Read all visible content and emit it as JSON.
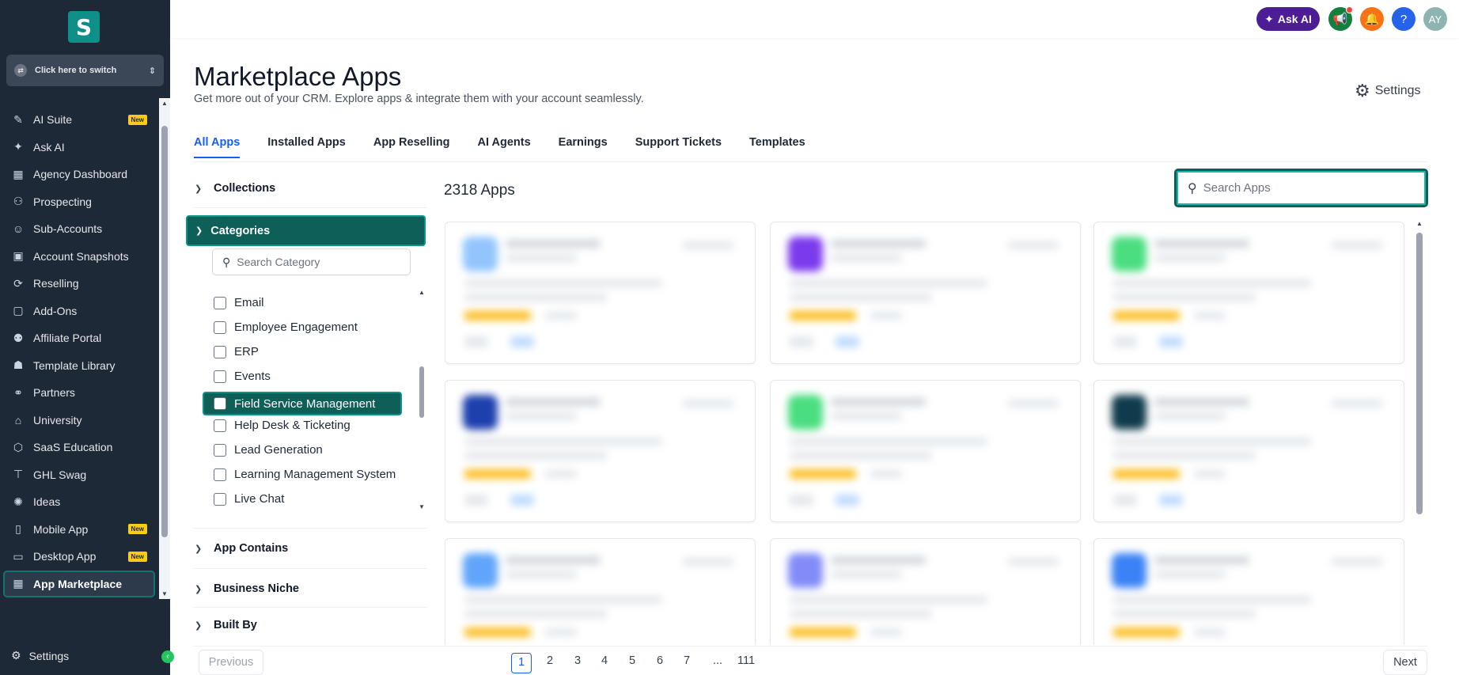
{
  "sidebar": {
    "switcher_label": "Click here to switch",
    "items": [
      {
        "label": "AI Suite",
        "badge": "New",
        "icon": "sparkle-pen-icon"
      },
      {
        "label": "Ask AI",
        "badge": "",
        "icon": "sparkles-icon"
      },
      {
        "label": "Agency Dashboard",
        "badge": "",
        "icon": "dashboard-icon"
      },
      {
        "label": "Prospecting",
        "badge": "",
        "icon": "user-search-icon"
      },
      {
        "label": "Sub-Accounts",
        "badge": "",
        "icon": "user-icon"
      },
      {
        "label": "Account Snapshots",
        "badge": "",
        "icon": "snapshot-icon"
      },
      {
        "label": "Reselling",
        "badge": "",
        "icon": "reselling-icon"
      },
      {
        "label": "Add-Ons",
        "badge": "",
        "icon": "bag-icon"
      },
      {
        "label": "Affiliate Portal",
        "badge": "",
        "icon": "people-icon"
      },
      {
        "label": "Template Library",
        "badge": "",
        "icon": "library-icon"
      },
      {
        "label": "Partners",
        "badge": "",
        "icon": "handshake-icon"
      },
      {
        "label": "University",
        "badge": "",
        "icon": "university-icon"
      },
      {
        "label": "SaaS Education",
        "badge": "",
        "icon": "cube-icon"
      },
      {
        "label": "GHL Swag",
        "badge": "",
        "icon": "shirt-icon"
      },
      {
        "label": "Ideas",
        "badge": "",
        "icon": "bulb-icon"
      },
      {
        "label": "Mobile App",
        "badge": "New",
        "icon": "mobile-icon"
      },
      {
        "label": "Desktop App",
        "badge": "New",
        "icon": "desktop-icon"
      },
      {
        "label": "App Marketplace",
        "badge": "",
        "icon": "grid-icon"
      }
    ],
    "settings_label": "Settings"
  },
  "topbar": {
    "ask_ai_label": "Ask AI",
    "avatar_initials": "AY",
    "help_label": "?"
  },
  "header": {
    "title": "Marketplace Apps",
    "subtitle": "Get more out of your CRM. Explore apps & integrate them with your account seamlessly.",
    "settings_label": "Settings"
  },
  "tabs": [
    "All Apps",
    "Installed Apps",
    "App Reselling",
    "AI Agents",
    "Earnings",
    "Support Tickets",
    "Templates"
  ],
  "filters": {
    "collections": "Collections",
    "categories": "Categories",
    "category_search_placeholder": "Search Category",
    "category_items": [
      "Email",
      "Employee Engagement",
      "ERP",
      "Events",
      "Field Service Management",
      "Help Desk & Ticketing",
      "Lead Generation",
      "Learning Management System",
      "Live Chat"
    ],
    "app_contains": "App Contains",
    "business_niche": "Business Niche",
    "built_by": "Built By"
  },
  "main": {
    "app_count": "2318 Apps",
    "search_placeholder": "Search Apps"
  },
  "pagination": {
    "previous": "Previous",
    "next": "Next",
    "pages": [
      "1",
      "2",
      "3",
      "4",
      "5",
      "6",
      "7",
      "...",
      "111"
    ],
    "current": "1"
  },
  "colors": {
    "sidebar_bg": "#1e2937",
    "accent_teal": "#0f5f59",
    "tab_active": "#155eef",
    "ask_ai_bg": "#4c1d95"
  }
}
